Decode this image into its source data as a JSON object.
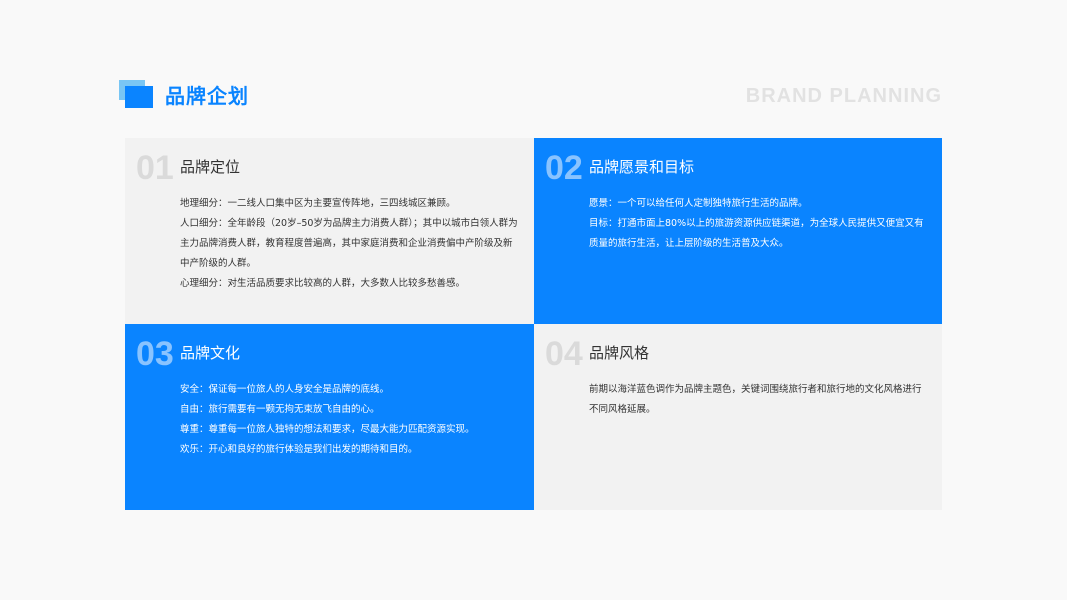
{
  "header": {
    "title": "品牌企划",
    "subtitle_en": "BRAND PLANNING",
    "accent_color": "#0a84ff"
  },
  "cards": [
    {
      "number": "01",
      "title": "品牌定位",
      "theme": "light",
      "lines": [
        "地理细分：一二线人口集中区为主要宣传阵地，三四线城区兼顾。",
        "人口细分：全年龄段（20岁–50岁为品牌主力消费人群）；其中以城市白领人群为主力品牌消费人群，教育程度普遍高，其中家庭消费和企业消费偏中产阶级及新中产阶级的人群。",
        "心理细分：对生活品质要求比较高的人群，大多数人比较多愁善感。"
      ]
    },
    {
      "number": "02",
      "title": "品牌愿景和目标",
      "theme": "blue",
      "lines": [
        "愿景：一个可以给任何人定制独特旅行生活的品牌。",
        "目标：打通市面上80%以上的旅游资源供应链渠道，为全球人民提供又便宜又有质量的旅行生活，让上层阶级的生活普及大众。"
      ]
    },
    {
      "number": "03",
      "title": "品牌文化",
      "theme": "blue",
      "lines": [
        "安全：保证每一位旅人的人身安全是品牌的底线。",
        "自由：旅行需要有一颗无拘无束放飞自由的心。",
        "尊重：尊重每一位旅人独特的想法和要求，尽最大能力匹配资源实现。",
        "欢乐：开心和良好的旅行体验是我们出发的期待和目的。"
      ]
    },
    {
      "number": "04",
      "title": "品牌风格",
      "theme": "light",
      "lines": [
        "前期以海洋蓝色调作为品牌主题色，关键词围绕旅行者和旅行地的文化风格进行不同风格延展。"
      ]
    }
  ]
}
